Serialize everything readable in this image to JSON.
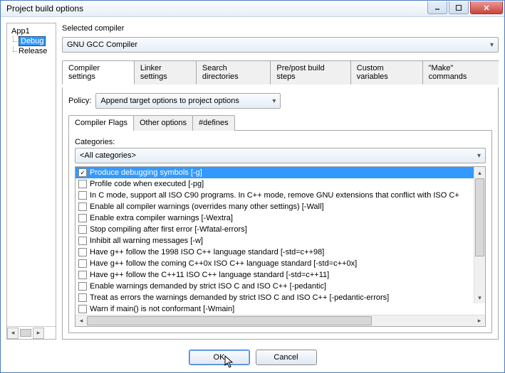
{
  "window": {
    "title": "Project build options"
  },
  "tree": {
    "root": "App1",
    "items": [
      "Debug",
      "Release"
    ],
    "selected": "Debug"
  },
  "compiler": {
    "label": "Selected compiler",
    "value": "GNU GCC Compiler"
  },
  "tabs": {
    "items": [
      "Compiler settings",
      "Linker settings",
      "Search directories",
      "Pre/post build steps",
      "Custom variables",
      "\"Make\" commands"
    ],
    "active": 0
  },
  "policy": {
    "label": "Policy:",
    "value": "Append target options to project options"
  },
  "inner_tabs": {
    "items": [
      "Compiler Flags",
      "Other options",
      "#defines"
    ],
    "active": 0
  },
  "categories": {
    "label": "Categories:",
    "value": "<All categories>"
  },
  "flags": [
    {
      "checked": true,
      "label": "Produce debugging symbols  [-g]"
    },
    {
      "checked": false,
      "label": "Profile code when executed  [-pg]"
    },
    {
      "checked": false,
      "label": "In C mode, support all ISO C90 programs. In C++ mode, remove GNU extensions that conflict with ISO C+"
    },
    {
      "checked": false,
      "label": "Enable all compiler warnings (overrides many other settings)  [-Wall]"
    },
    {
      "checked": false,
      "label": "Enable extra compiler warnings  [-Wextra]"
    },
    {
      "checked": false,
      "label": "Stop compiling after first error  [-Wfatal-errors]"
    },
    {
      "checked": false,
      "label": "Inhibit all warning messages  [-w]"
    },
    {
      "checked": false,
      "label": "Have g++ follow the 1998 ISO C++ language standard  [-std=c++98]"
    },
    {
      "checked": false,
      "label": "Have g++ follow the coming C++0x ISO C++ language standard  [-std=c++0x]"
    },
    {
      "checked": false,
      "label": "Have g++ follow the C++11 ISO C++ language standard  [-std=c++11]"
    },
    {
      "checked": false,
      "label": "Enable warnings demanded by strict ISO C and ISO C++  [-pedantic]"
    },
    {
      "checked": false,
      "label": "Treat as errors the warnings demanded by strict ISO C and ISO C++  [-pedantic-errors]"
    },
    {
      "checked": false,
      "label": "Warn if main() is not conformant  [-Wmain]"
    }
  ],
  "selected_flag": 0,
  "buttons": {
    "ok": "OK",
    "cancel": "Cancel"
  }
}
